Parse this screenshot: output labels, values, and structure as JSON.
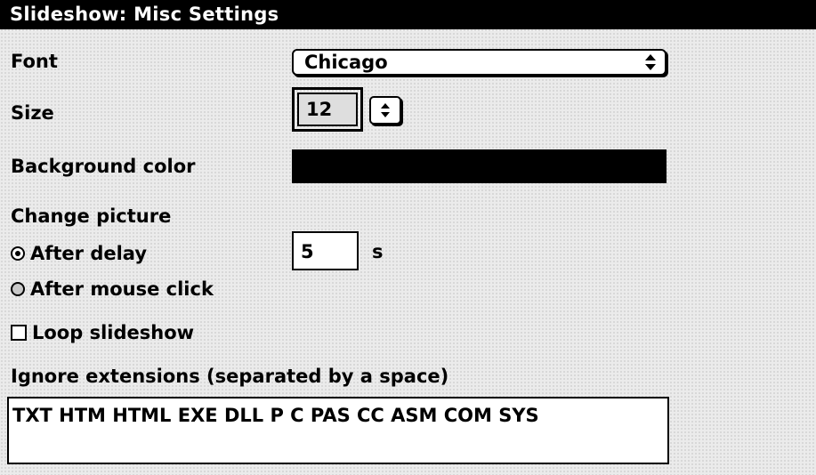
{
  "window": {
    "title": "Slideshow: Misc Settings"
  },
  "font_setting": {
    "label": "Font",
    "value": "Chicago"
  },
  "size_setting": {
    "label": "Size",
    "value": "12"
  },
  "background_setting": {
    "label": "Background color",
    "color": "#000000"
  },
  "change_picture": {
    "heading": "Change picture",
    "options": [
      {
        "label": "After delay",
        "selected": true
      },
      {
        "label": "After mouse click",
        "selected": false
      }
    ],
    "delay_value": "5",
    "delay_unit": "s"
  },
  "loop": {
    "label": "Loop slideshow",
    "checked": false
  },
  "ignore_extensions": {
    "label": "Ignore extensions (separated by a space)",
    "value": "TXT HTM HTML EXE DLL P C PAS CC ASM COM SYS"
  }
}
